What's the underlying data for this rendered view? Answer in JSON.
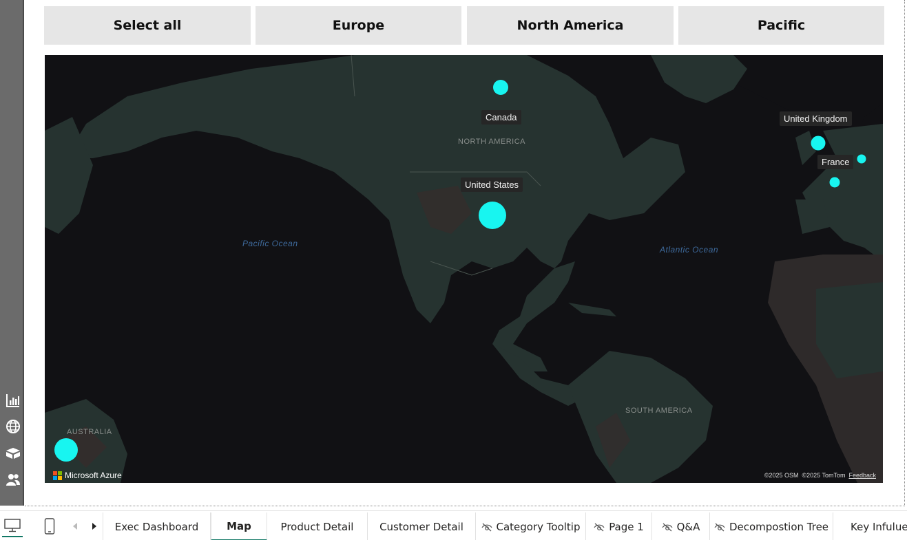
{
  "slicer": {
    "items": [
      {
        "label": "Select all"
      },
      {
        "label": "Europe"
      },
      {
        "label": "North America"
      },
      {
        "label": "Pacific"
      }
    ]
  },
  "map": {
    "countries": [
      {
        "name": "Canada"
      },
      {
        "name": "United Kingdom"
      },
      {
        "name": "France"
      },
      {
        "name": "United States"
      }
    ],
    "regions": [
      "NORTH AMERICA",
      "SOUTH AMERICA",
      "AUSTRALIA"
    ],
    "oceans": [
      "Pacific Ocean",
      "Atlantic Ocean"
    ],
    "provider": "Microsoft Azure",
    "attribution": {
      "osm": "©2025 OSM",
      "tomtom": "©2025 TomTom",
      "feedback": "Feedback"
    },
    "bubble_color": "#18f5f0"
  },
  "left_rail": {
    "icons": [
      "bar-chart-icon",
      "globe-icon",
      "boxes-icon",
      "people-icon"
    ]
  },
  "tabs": {
    "items": [
      {
        "label": "Exec Dashboard",
        "hidden": false
      },
      {
        "label": "Map",
        "hidden": false,
        "active": true
      },
      {
        "label": "Product Detail",
        "hidden": false
      },
      {
        "label": "Customer Detail",
        "hidden": false
      },
      {
        "label": "Category Tooltip",
        "hidden": true
      },
      {
        "label": "Page 1",
        "hidden": true
      },
      {
        "label": "Q&A",
        "hidden": true
      },
      {
        "label": "Decompostion Tree",
        "hidden": true
      },
      {
        "label": "Key Infuluen",
        "hidden": false
      }
    ],
    "accent": "#117865"
  }
}
